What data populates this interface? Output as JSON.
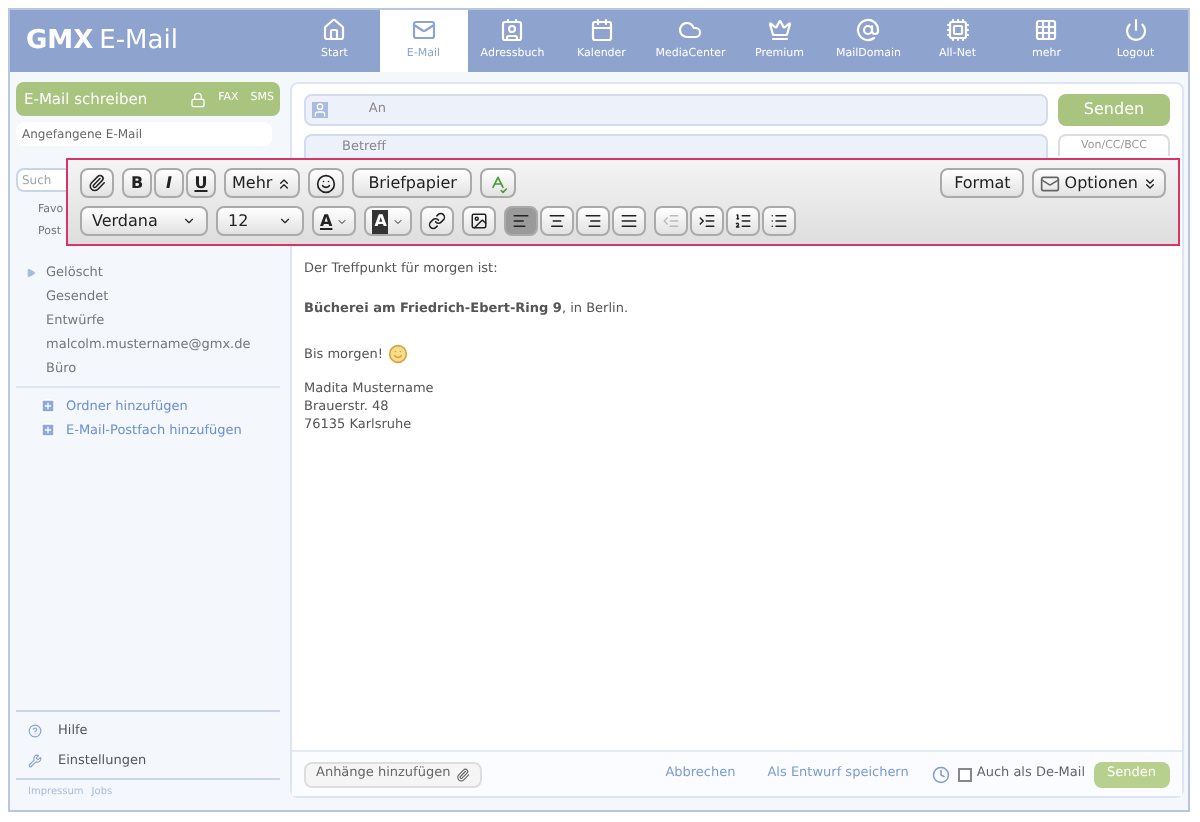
{
  "header": {
    "logo_bold": "GMX",
    "logo_rest": "E-Mail",
    "nav": [
      {
        "label": "Start",
        "selected": false
      },
      {
        "label": "E-Mail",
        "selected": true
      },
      {
        "label": "Adressbuch",
        "selected": false
      },
      {
        "label": "Kalender",
        "selected": false
      },
      {
        "label": "MediaCenter",
        "selected": false
      },
      {
        "label": "Premium",
        "selected": false
      },
      {
        "label": "MailDomain",
        "selected": false
      },
      {
        "label": "All-Net",
        "selected": false
      },
      {
        "label": "mehr",
        "selected": false
      },
      {
        "label": "Logout",
        "selected": false
      }
    ]
  },
  "sidebar": {
    "compose": "E-Mail schreiben",
    "fax": "FAX",
    "sms": "SMS",
    "draft_field": "Angefangene E-Mail",
    "search_partial": "Such",
    "folders_partial": [
      "Favo",
      "Post"
    ],
    "folders": [
      {
        "label": "Gelöscht",
        "expandable": true
      },
      {
        "label": "Gesendet",
        "expandable": false
      },
      {
        "label": "Entwürfe",
        "expandable": false
      },
      {
        "label": "malcolm.mustername@gmx.de",
        "expandable": false
      },
      {
        "label": "Büro",
        "expandable": false
      }
    ],
    "add_links": [
      "Ordner hinzufügen",
      "E-Mail-Postfach hinzufügen"
    ],
    "bottom": [
      "Hilfe",
      "Einstellungen"
    ],
    "footer_links": [
      "Impressum",
      "Jobs"
    ]
  },
  "compose": {
    "to_label": "An",
    "subject_label": "Betreff",
    "send": "Senden",
    "cc_toggle": "Von/CC/BCC",
    "body": [
      "Der Treffpunkt für morgen ist:",
      "**Bücherei am Friedrich-Ebert-Ring 9**, in Berlin.",
      "Bis morgen!"
    ],
    "signature": [
      "Madita Mustername",
      "Brauerstr. 48",
      "76135 Karlsruhe"
    ],
    "attach": "Anhänge hinzufügen",
    "cancel": "Abbrechen",
    "save_draft": "Als Entwurf speichern",
    "de_mail": {
      "label": "Auch als De-Mail",
      "checked": false
    },
    "send_bottom": "Senden"
  },
  "toolbar": {
    "bold": "B",
    "italic": "I",
    "underline": "U",
    "more": "Mehr",
    "stationery": "Briefpapier",
    "format": "Format",
    "options": "Optionen",
    "font": "Verdana",
    "size": "12",
    "text_color": "A",
    "highlight_color": "A",
    "align": [
      {
        "kind": "left",
        "selected": true
      },
      {
        "kind": "center",
        "selected": false
      },
      {
        "kind": "right",
        "selected": false
      },
      {
        "kind": "justify",
        "selected": false
      }
    ],
    "indent": [
      {
        "kind": "outdent",
        "disabled": true
      },
      {
        "kind": "indent",
        "disabled": false
      },
      {
        "kind": "ordered",
        "disabled": false
      },
      {
        "kind": "bullets",
        "disabled": false
      }
    ]
  }
}
